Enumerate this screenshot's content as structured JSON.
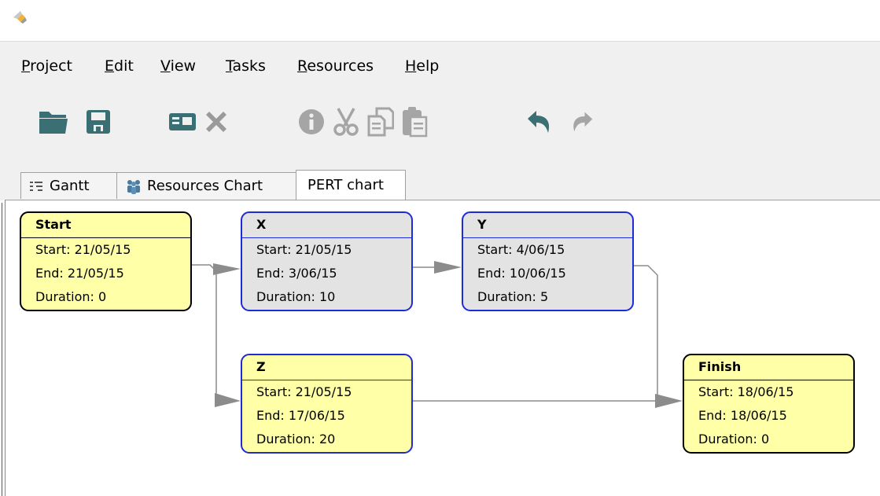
{
  "menu": [
    "Project",
    "Edit",
    "View",
    "Tasks",
    "Resources",
    "Help"
  ],
  "toolbar": {
    "icons": [
      "open-folder-icon",
      "save-icon",
      "properties-icon",
      "delete-icon",
      "info-icon",
      "cut-icon",
      "copy-icon",
      "paste-icon",
      "undo-icon",
      "redo-icon"
    ]
  },
  "tabs": [
    {
      "label": "Gantt",
      "icon": "gantt-icon",
      "active": false
    },
    {
      "label": "Resources Chart",
      "icon": "people-icon",
      "active": false
    },
    {
      "label": "PERT chart",
      "icon": "",
      "active": true
    }
  ],
  "pert": {
    "nodes": [
      {
        "id": "start",
        "title": "Start",
        "start": "Start: 21/05/15",
        "end": "End: 21/05/15",
        "duration": "Duration: 0",
        "fill": "yellow",
        "critical": false
      },
      {
        "id": "x",
        "title": "X",
        "start": "Start: 21/05/15",
        "end": "End: 3/06/15",
        "duration": "Duration: 10",
        "fill": "gray",
        "critical": true
      },
      {
        "id": "y",
        "title": "Y",
        "start": "Start: 4/06/15",
        "end": "End: 10/06/15",
        "duration": "Duration: 5",
        "fill": "gray",
        "critical": true
      },
      {
        "id": "z",
        "title": "Z",
        "start": "Start: 21/05/15",
        "end": "End: 17/06/15",
        "duration": "Duration: 20",
        "fill": "yellow",
        "critical": true
      },
      {
        "id": "finish",
        "title": "Finish",
        "start": "Start: 18/06/15",
        "end": "End: 18/06/15",
        "duration": "Duration: 0",
        "fill": "yellow",
        "critical": false
      }
    ],
    "edges": [
      {
        "from": "start",
        "to": "x"
      },
      {
        "from": "start",
        "to": "z"
      },
      {
        "from": "x",
        "to": "y"
      },
      {
        "from": "y",
        "to": "finish"
      },
      {
        "from": "z",
        "to": "finish"
      }
    ]
  },
  "colors": {
    "menu_bg": "#f0f0f0",
    "task_fill": "#ffffa8",
    "completed_fill": "#e3e3e3",
    "critical_border": "#1e2cd6",
    "edge": "#8c8c8c",
    "toolbar_icon": "#3a6f73"
  }
}
